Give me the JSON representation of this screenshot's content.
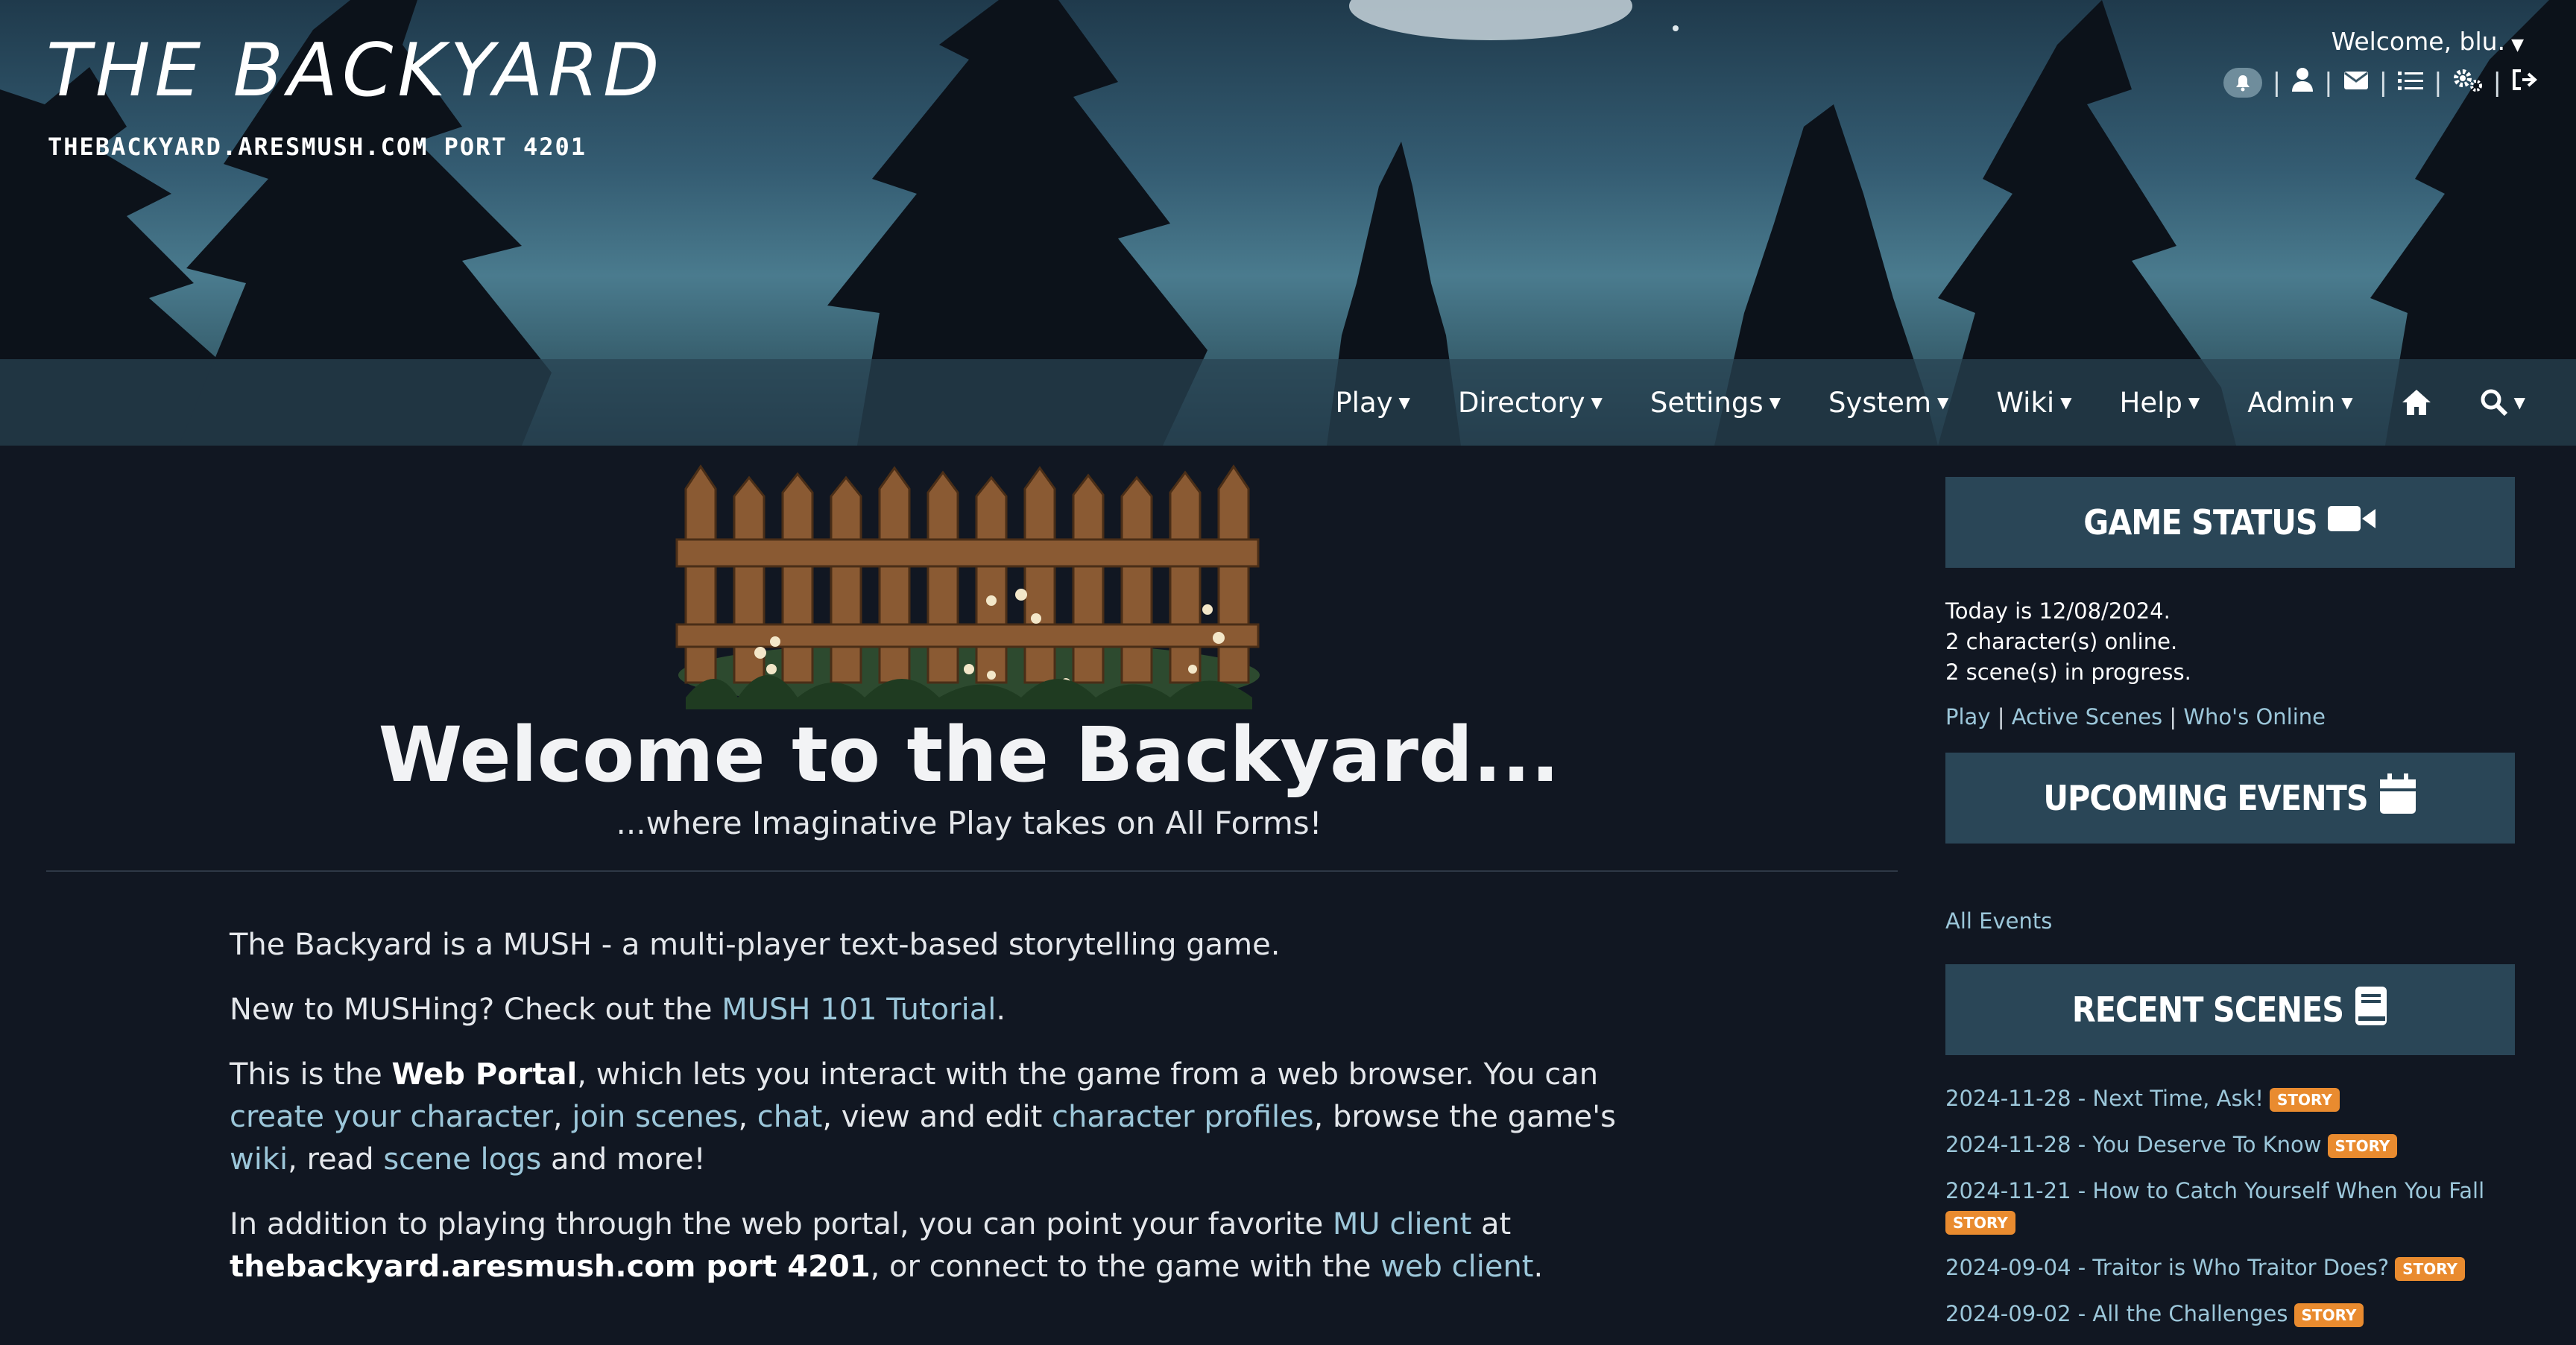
{
  "header": {
    "title": "THE BACKYARD",
    "subtitle": "THEBACKYARD.ARESMUSH.COM PORT 4201",
    "welcome": "Welcome, blu.",
    "toolbar_icons": [
      "bell-icon",
      "user-icon",
      "envelope-icon",
      "list-icon",
      "cogs-icon",
      "sign-out-icon"
    ]
  },
  "nav": {
    "items": [
      {
        "label": "Play"
      },
      {
        "label": "Directory"
      },
      {
        "label": "Settings"
      },
      {
        "label": "System"
      },
      {
        "label": "Wiki"
      },
      {
        "label": "Help"
      },
      {
        "label": "Admin"
      }
    ],
    "home_icon": "home-icon",
    "search_icon": "search-icon"
  },
  "hero": {
    "title": "Welcome to the Backyard...",
    "subtitle": "...where Imaginative Play takes on All Forms!"
  },
  "content": {
    "p1": "The Backyard is a MUSH - a multi-player text-based storytelling game.",
    "p2_prefix": "New to MUSHing? Check out the ",
    "p2_link": "MUSH 101 Tutorial",
    "p2_suffix": ".",
    "p3_a": "This is the ",
    "p3_bold": "Web Portal",
    "p3_b": ", which lets you interact with the game from a web browser. You can ",
    "p3_link1": "create your character",
    "p3_c": ", ",
    "p3_link2": "join scenes",
    "p3_d": ", ",
    "p3_link3": "chat",
    "p3_e": ", view and edit ",
    "p3_link4": "character profiles",
    "p3_f": ", browse the game's ",
    "p3_link5": "wiki",
    "p3_g": ", read ",
    "p3_link6": "scene logs",
    "p3_h": " and more!",
    "p4_a": "In addition to playing through the web portal, you can point your favorite ",
    "p4_link1": "MU client",
    "p4_b": " at ",
    "p4_bold": "thebackyard.aresmush.com port 4201",
    "p4_c": ", or connect to the game with the ",
    "p4_link2": "web client",
    "p4_d": "."
  },
  "sidebar": {
    "game_status": {
      "heading": "GAME STATUS",
      "icon": "video-camera-icon",
      "line1": "Today is 12/08/2024.",
      "line2": "2 character(s) online.",
      "line3": "2 scene(s) in progress.",
      "link_play": "Play",
      "link_active": "Active Scenes",
      "link_online": "Who's Online",
      "separator": "|"
    },
    "upcoming_events": {
      "heading": "UPCOMING EVENTS",
      "icon": "calendar-icon",
      "all_link": "All Events"
    },
    "recent_scenes": {
      "heading": "RECENT SCENES",
      "icon": "book-icon",
      "badge": "STORY",
      "items": [
        {
          "text": "2024-11-28 - Next Time, Ask!"
        },
        {
          "text": "2024-11-28 - You Deserve To Know"
        },
        {
          "text": "2024-11-21 - How to Catch Yourself When You Fall"
        },
        {
          "text": "2024-09-04 - Traitor is Who Traitor Does?"
        },
        {
          "text": "2024-09-02 - All the Challenges"
        }
      ]
    }
  },
  "colors": {
    "page_bg": "#111722",
    "panel_bg": "#2a4657",
    "link": "#9cc7da",
    "badge": "#e98b2f"
  }
}
